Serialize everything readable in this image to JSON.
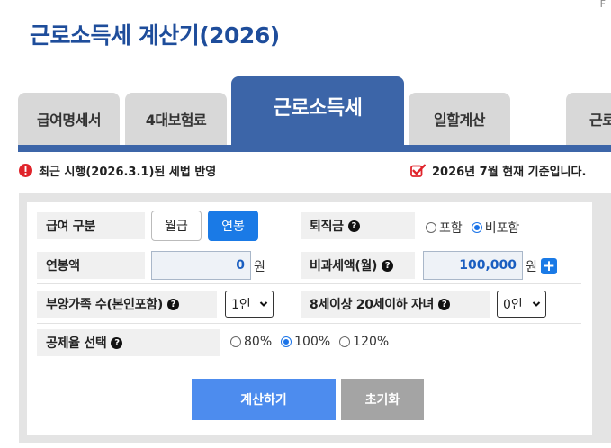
{
  "corner_mark": "F",
  "title": "근로소득세 계산기(2026)",
  "tabs": [
    {
      "label": "급여명세서",
      "active": false
    },
    {
      "label": "4대보험료",
      "active": false
    },
    {
      "label": "근로소득세",
      "active": true
    },
    {
      "label": "일할계산",
      "active": false
    },
    {
      "label": "근로",
      "active": false
    }
  ],
  "notices": {
    "left": "최근 시행(2026.3.1)된 세법 반영",
    "right": "2026년 7월 현재 기준입니다."
  },
  "form": {
    "salary_type": {
      "label": "급여 구분",
      "options": [
        "월급",
        "연봉"
      ],
      "selected": "연봉"
    },
    "severance": {
      "label": "퇴직금",
      "options": [
        "포함",
        "비포함"
      ],
      "selected": "비포함"
    },
    "annual_salary": {
      "label": "연봉액",
      "value": "0",
      "unit": "원"
    },
    "nontax_amount": {
      "label": "비과세액(월)",
      "value": "100,000",
      "unit": "원"
    },
    "dependents": {
      "label": "부양가족 수(본인포함)",
      "value": "1인"
    },
    "children": {
      "label": "8세이상 20세이하 자녀",
      "value": "0인"
    },
    "deduction_rate": {
      "label": "공제율 선택",
      "options": [
        "80%",
        "100%",
        "120%"
      ],
      "selected": "100%"
    },
    "calculate_button": "계산하기",
    "reset_button": "초기화"
  },
  "colors": {
    "brand": "#1e4d9b",
    "tab_active": "#3c65a8",
    "primary_button": "#4d8cee",
    "toggle_active": "#1a7ae6",
    "reset_button": "#a4a4a4",
    "notice_icon": "#e0242b"
  },
  "icons": {
    "notice_left": "exclamation-circle-icon",
    "notice_right": "checkbox-checked-icon",
    "help": "question-circle-icon",
    "add": "plus-icon",
    "select": "chevron-down-icon"
  }
}
